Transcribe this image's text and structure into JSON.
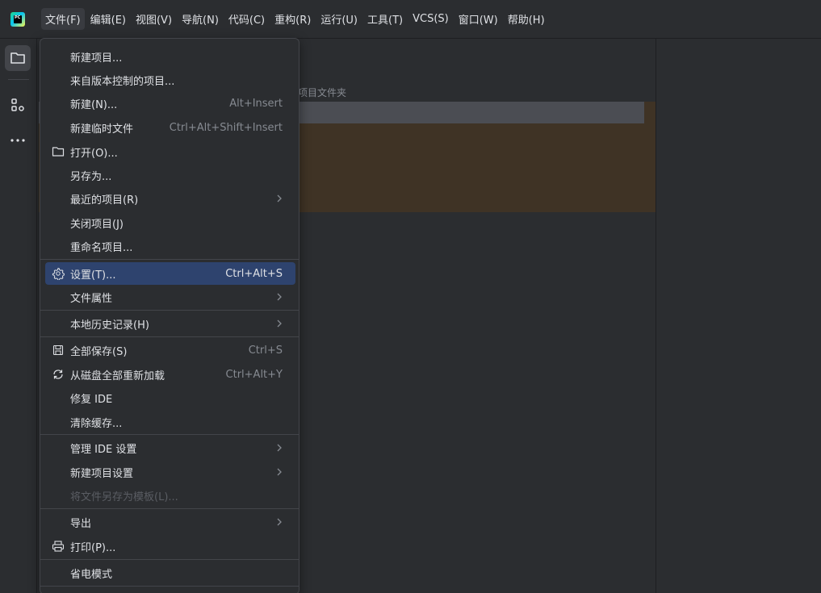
{
  "menubar": {
    "items": [
      "文件(F)",
      "编辑(E)",
      "视图(V)",
      "导航(N)",
      "代码(C)",
      "重构(R)",
      "运行(U)",
      "工具(T)",
      "VCS(S)",
      "窗口(W)",
      "帮助(H)"
    ]
  },
  "editor": {
    "project_hint": "项目文件夹"
  },
  "file_menu": {
    "new_project": "新建项目...",
    "from_vcs": "来自版本控制的项目...",
    "new": "新建(N)...",
    "new_shortcut": "Alt+Insert",
    "new_scratch": "新建临时文件",
    "new_scratch_shortcut": "Ctrl+Alt+Shift+Insert",
    "open": "打开(O)...",
    "save_as": "另存为...",
    "recent_projects": "最近的项目(R)",
    "close_project": "关闭项目(J)",
    "rename_project": "重命名项目...",
    "settings": "设置(T)...",
    "settings_shortcut": "Ctrl+Alt+S",
    "file_properties": "文件属性",
    "local_history": "本地历史记录(H)",
    "save_all": "全部保存(S)",
    "save_all_shortcut": "Ctrl+S",
    "reload_all": "从磁盘全部重新加载",
    "reload_all_shortcut": "Ctrl+Alt+Y",
    "repair_ide": "修复 IDE",
    "invalidate_caches": "清除缓存...",
    "manage_ide_settings": "管理 IDE 设置",
    "new_project_settings": "新建项目设置",
    "save_as_template": "将文件另存为模板(L)...",
    "export": "导出",
    "print": "打印(P)...",
    "power_save": "省电模式"
  },
  "colors": {
    "selection": "#2e436e",
    "menu_bg": "#2b2d30",
    "text": "#dfe1e5",
    "shortcut": "#868a91",
    "disabled": "#5a5d63"
  }
}
